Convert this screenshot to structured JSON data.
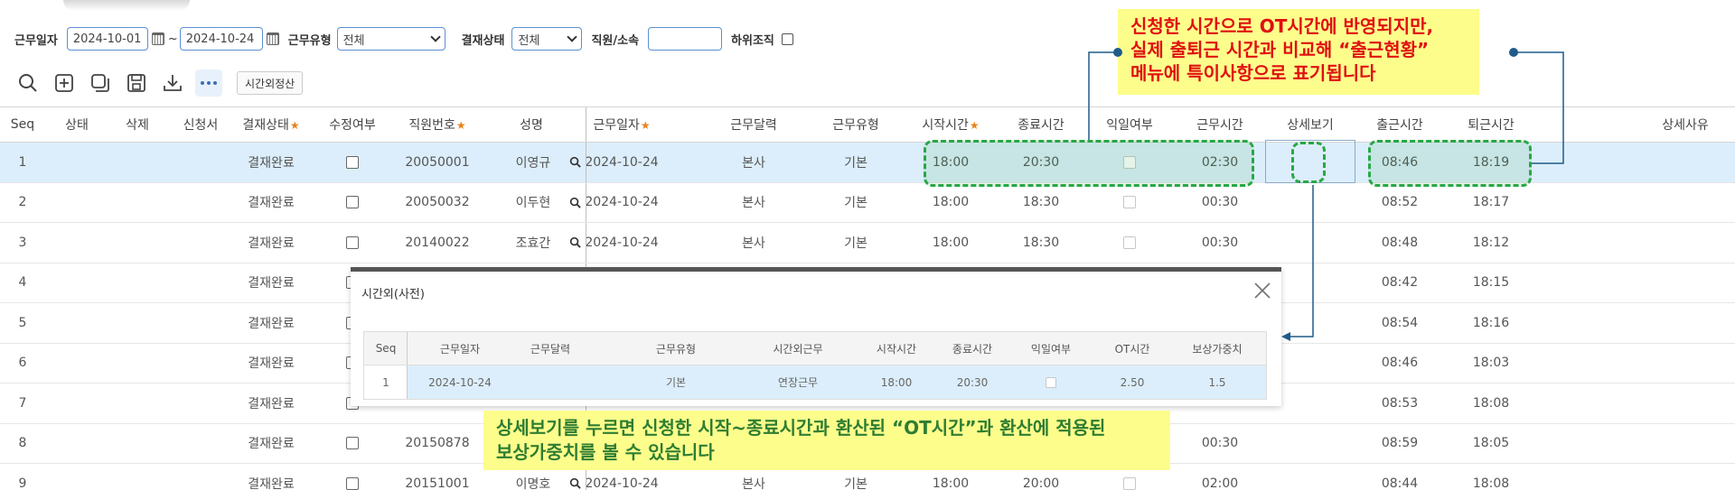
{
  "filters": {
    "work_date_label": "근무일자",
    "date_from": "2024-10-01",
    "date_sep": "~",
    "date_to": "2024-10-24",
    "work_type_label": "근무유형",
    "work_type_value": "전체",
    "approval_label": "결재상태",
    "approval_value": "전체",
    "employee_label": "직원/소속",
    "employee_value": "",
    "suborg_label": "하위조직"
  },
  "toolbar": {
    "overtime_button": "시간외정산"
  },
  "grid": {
    "headers": [
      {
        "label": "Seq",
        "star": false
      },
      {
        "label": "상태",
        "star": false
      },
      {
        "label": "삭제",
        "star": false
      },
      {
        "label": "신청서",
        "star": false
      },
      {
        "label": "결재상태",
        "star": true
      },
      {
        "label": "수정여부",
        "star": false
      },
      {
        "label": "직원번호",
        "star": true
      },
      {
        "label": "성명",
        "star": false
      },
      {
        "label": "근무일자",
        "star": true
      },
      {
        "label": "근무달력",
        "star": false
      },
      {
        "label": "근무유형",
        "star": false
      },
      {
        "label": "시작시간",
        "star": true
      },
      {
        "label": "종료시간",
        "star": false
      },
      {
        "label": "익일여부",
        "star": false
      },
      {
        "label": "근무시간",
        "star": false
      },
      {
        "label": "상세보기",
        "star": false
      },
      {
        "label": "출근시간",
        "star": false
      },
      {
        "label": "퇴근시간",
        "star": false
      },
      {
        "label": "상세사유",
        "star": false
      }
    ],
    "rows": [
      {
        "seq": "1",
        "approval": "결재완료",
        "emp_no": "20050001",
        "name": "이영규",
        "date": "2024-10-24",
        "calendar": "본사",
        "type": "기본",
        "start": "18:00",
        "end": "20:30",
        "hours": "02:30",
        "in": "08:46",
        "out": "18:19"
      },
      {
        "seq": "2",
        "approval": "결재완료",
        "emp_no": "20050032",
        "name": "이두현",
        "date": "2024-10-24",
        "calendar": "본사",
        "type": "기본",
        "start": "18:00",
        "end": "18:30",
        "hours": "00:30",
        "in": "08:52",
        "out": "18:17"
      },
      {
        "seq": "3",
        "approval": "결재완료",
        "emp_no": "20140022",
        "name": "조효간",
        "date": "2024-10-24",
        "calendar": "본사",
        "type": "기본",
        "start": "18:00",
        "end": "18:30",
        "hours": "00:30",
        "in": "08:48",
        "out": "18:12"
      },
      {
        "seq": "4",
        "approval": "결재완료",
        "in": "08:42",
        "out": "18:15"
      },
      {
        "seq": "5",
        "approval": "결재완료",
        "in": "08:54",
        "out": "18:16"
      },
      {
        "seq": "6",
        "approval": "결재완료",
        "in": "08:46",
        "out": "18:03"
      },
      {
        "seq": "7",
        "approval": "결재완료",
        "in": "08:53",
        "out": "18:08"
      },
      {
        "seq": "8",
        "approval": "결재완료",
        "emp_no": "20150878",
        "hours": "00:30",
        "in": "08:59",
        "out": "18:05"
      },
      {
        "seq": "9",
        "approval": "결재완료",
        "emp_no": "20151001",
        "name": "이명호",
        "date": "2024-10-24",
        "calendar": "본사",
        "type": "기본",
        "start": "18:00",
        "end": "20:00",
        "hours": "02:00",
        "in": "08:44",
        "out": "18:08"
      }
    ]
  },
  "popup": {
    "title": "시간외(사전)",
    "headers": [
      "Seq",
      "근무일자",
      "근무달력",
      "근무유형",
      "시간외근무",
      "시작시간",
      "종료시간",
      "익일여부",
      "OT시간",
      "보상가중치"
    ],
    "row": {
      "seq": "1",
      "date": "2024-10-24",
      "calendar": "",
      "type": "기본",
      "ot_kind": "연장근무",
      "start": "18:00",
      "end": "20:30",
      "ot_hours": "2.50",
      "weight": "1.5"
    }
  },
  "callouts": {
    "top": [
      "신청한 시간으로 OT시간에 반영되지만,",
      "실제 출퇴근 시간과 비교해 “출근현황”",
      "메뉴에 특이사항으로 표기됩니다"
    ],
    "bottom": [
      "상세보기를 누르면 신청한 시작~종료시간과 환산된 “OT시간”과 환산에 적용된",
      "보상가중치를 볼 수 있습니다"
    ]
  },
  "colors": {
    "accent_blue": "#5b8fd6",
    "selected_row": "#dceefb",
    "highlight_green": "#28a745",
    "callout_bg": "#fdfd8c",
    "callout_red": "#e01010",
    "callout_green": "#2e7d32",
    "required_star": "#e8831a"
  }
}
